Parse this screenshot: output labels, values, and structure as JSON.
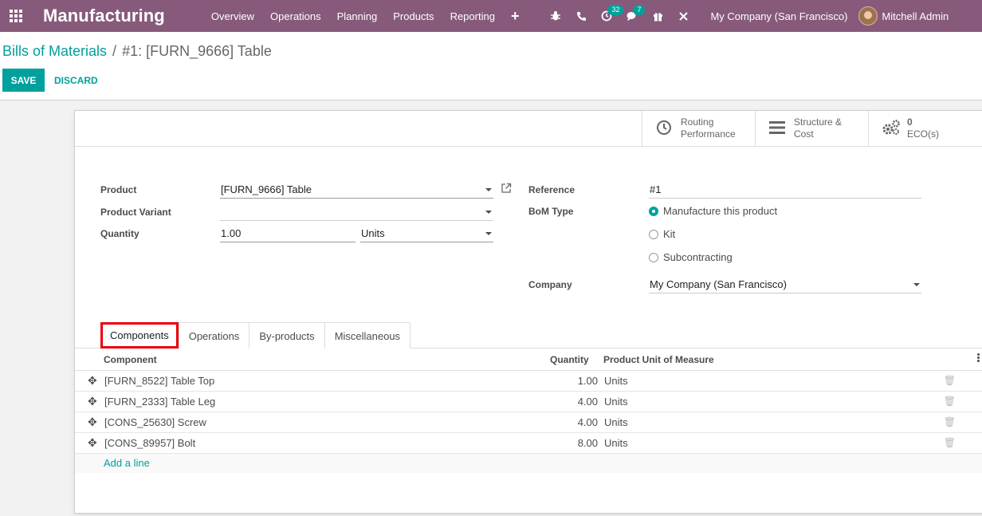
{
  "navbar": {
    "app_title": "Manufacturing",
    "menu": [
      "Overview",
      "Operations",
      "Planning",
      "Products",
      "Reporting"
    ],
    "plus": "+",
    "activity_count": "32",
    "messages_count": "7",
    "company": "My Company (San Francisco)",
    "user": "Mitchell Admin"
  },
  "breadcrumb": {
    "parent": "Bills of Materials",
    "separator": "/",
    "current": "#1: [FURN_9666] Table"
  },
  "actions": {
    "save": "SAVE",
    "discard": "DISCARD"
  },
  "stat_buttons": {
    "routing_line1": "Routing",
    "routing_line2": "Performance",
    "structure_line1": "Structure &",
    "structure_line2": "Cost",
    "eco_count": "0",
    "eco_label": "ECO(s)"
  },
  "form": {
    "product_label": "Product",
    "product_value": "[FURN_9666] Table",
    "variant_label": "Product Variant",
    "variant_value": "",
    "quantity_label": "Quantity",
    "quantity_value": "1.00",
    "uom_value": "Units",
    "reference_label": "Reference",
    "reference_value": "#1",
    "bom_type_label": "BoM Type",
    "bom_types": [
      "Manufacture this product",
      "Kit",
      "Subcontracting"
    ],
    "bom_type_selected": "Manufacture this product",
    "company_label": "Company",
    "company_value": "My Company (San Francisco)"
  },
  "tabs": [
    "Components",
    "Operations",
    "By-products",
    "Miscellaneous"
  ],
  "active_tab": "Components",
  "components_table": {
    "headers": {
      "component": "Component",
      "quantity": "Quantity",
      "uom": "Product Unit of Measure"
    },
    "rows": [
      {
        "component": "[FURN_8522] Table Top",
        "quantity": "1.00",
        "uom": "Units"
      },
      {
        "component": "[FURN_2333] Table Leg",
        "quantity": "4.00",
        "uom": "Units"
      },
      {
        "component": "[CONS_25630] Screw",
        "quantity": "4.00",
        "uom": "Units"
      },
      {
        "component": "[CONS_89957] Bolt",
        "quantity": "8.00",
        "uom": "Units"
      }
    ],
    "add_line": "Add a line"
  },
  "colors": {
    "navbar": "#875a7b",
    "accent": "#00a09d",
    "highlight": "#e8000b"
  }
}
